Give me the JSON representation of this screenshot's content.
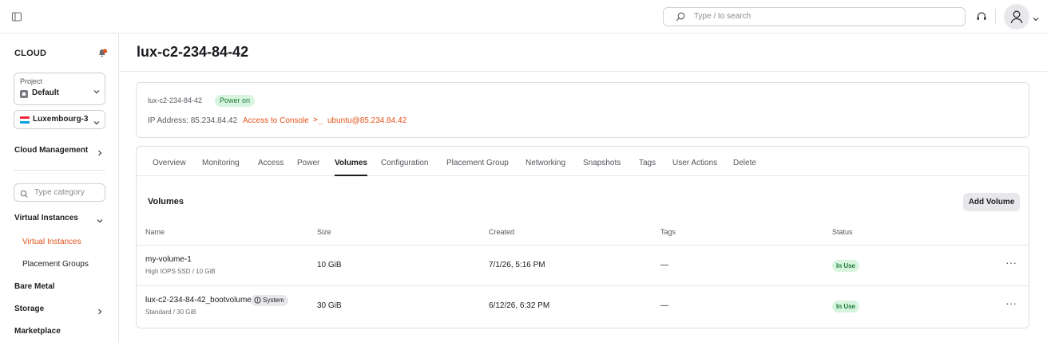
{
  "header": {
    "search_placeholder": "Type / to search"
  },
  "sidebar": {
    "title": "CLOUD",
    "project_label": "Project",
    "project_value": "Default",
    "region_value": "Luxembourg-3",
    "cloud_management": "Cloud Management",
    "category_placeholder": "Type category",
    "virtual_instances_group": "Virtual Instances",
    "virtual_instances_item": "Virtual Instances",
    "placement_groups_item": "Placement Groups",
    "bare_metal": "Bare Metal",
    "storage": "Storage",
    "marketplace": "Marketplace"
  },
  "page": {
    "title": "lux-c2-234-84-42"
  },
  "info": {
    "name": "lux-c2-234-84-42",
    "power_status": "Power on",
    "ip_address": "IP Address: 85.234.84.42",
    "console_link": "Access to Console",
    "terminal_glyph": ">_",
    "ssh_link": "ubuntu@85.234.84.42"
  },
  "tabs": [
    {
      "label": "Overview"
    },
    {
      "label": "Monitoring"
    },
    {
      "label": "Access"
    },
    {
      "label": "Power"
    },
    {
      "label": "Volumes"
    },
    {
      "label": "Configuration"
    },
    {
      "label": "Placement Group"
    },
    {
      "label": "Networking"
    },
    {
      "label": "Snapshots"
    },
    {
      "label": "Tags"
    },
    {
      "label": "User Actions"
    },
    {
      "label": "Delete"
    }
  ],
  "volumes": {
    "title": "Volumes",
    "add_button": "Add Volume",
    "columns": [
      "Name",
      "Size",
      "Created",
      "Tags",
      "Status"
    ],
    "rows": [
      {
        "name": "my-volume-1",
        "type": "High IOPS SSD / 10 GiB",
        "size": "10 GiB",
        "created": "7/1/26, 5:16 PM",
        "tags": "—",
        "status": "In Use",
        "badge": ""
      },
      {
        "name": "lux-c2-234-84-42_bootvolume",
        "type": "Standard / 30 GiB",
        "size": "30 GiB",
        "created": "6/12/26, 6:32 PM",
        "tags": "—",
        "status": "In Use",
        "badge": "System"
      }
    ],
    "more_glyph": "···"
  },
  "colors": {
    "accent": "#e2531b",
    "status_green_bg": "#d7f4de",
    "status_green_text": "#1d7a3a"
  },
  "icons": {
    "sidebar_toggle": "sidebar-toggle-icon",
    "search": "search-icon",
    "support": "headset-icon",
    "user": "user-icon",
    "notification": "bell-icon"
  }
}
